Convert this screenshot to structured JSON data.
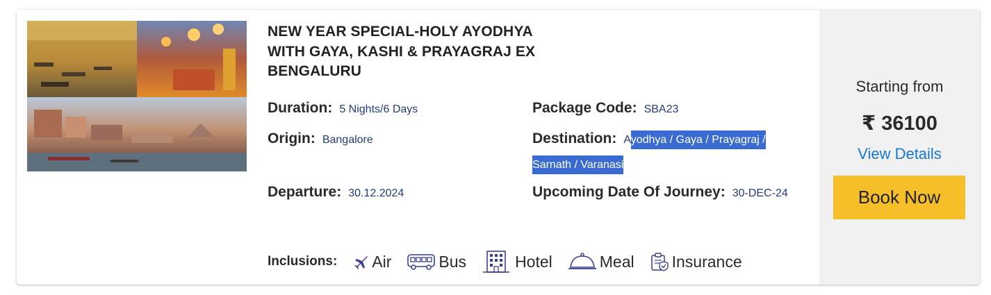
{
  "package": {
    "title": "NEW YEAR SPECIAL-HOLY AYODHYA WITH GAYA, KASHI & PRAYAGRAJ EX BENGALURU",
    "duration_label": "Duration:",
    "duration_value": "5 Nights/6 Days",
    "code_label": "Package Code:",
    "code_value": "SBA23",
    "origin_label": "Origin:",
    "origin_value": "Bangalore",
    "destination_label": "Destination:",
    "destination_value_first": "A",
    "destination_value_selected": "yodhya / Gaya / Prayagraj / Sarnath / Varanasi",
    "departure_label": "Departure:",
    "departure_value": "30.12.2024",
    "journey_label": "Upcoming Date Of Journey:",
    "journey_value": "30-DEC-24"
  },
  "inclusions": {
    "label": "Inclusions:",
    "items": [
      {
        "icon": "plane-icon",
        "label": "Air"
      },
      {
        "icon": "bus-icon",
        "label": "Bus"
      },
      {
        "icon": "hotel-icon",
        "label": "Hotel"
      },
      {
        "icon": "meal-icon",
        "label": "Meal"
      },
      {
        "icon": "insurance-icon",
        "label": "Insurance"
      }
    ]
  },
  "pricing": {
    "starting_label": "Starting from",
    "price": "₹ 36100",
    "view_details": "View Details",
    "book_now": "Book Now"
  },
  "colors": {
    "accent_button": "#f6bf2a",
    "link": "#1877d2",
    "value_text": "#243b7a",
    "selection": "#3a6bd0",
    "icon": "#3b3f8f"
  }
}
